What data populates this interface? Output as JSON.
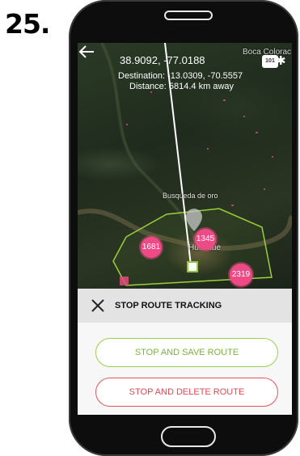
{
  "step": "25.",
  "map": {
    "current_coords": "38.9092, -77.0188",
    "destination": "Destination: -13.0309, -70.5557",
    "distance": "Distance: 5814.4 km away",
    "place_labels": {
      "boca": "Boca Colorac",
      "busqueda": "Busqueda de oro",
      "hue": "Hu... itue"
    },
    "road_shield": "101",
    "clusters": [
      {
        "label": "1681"
      },
      {
        "label": "1345"
      },
      {
        "label": "2319"
      }
    ]
  },
  "tracking": {
    "title": "STOP ROUTE TRACKING"
  },
  "actions": {
    "save_label": "STOP AND SAVE ROUTE",
    "delete_label": "STOP AND DELETE ROUTE"
  },
  "colors": {
    "accent_green": "#8ec63f",
    "accent_red": "#e2555f",
    "cluster_pink": "#ee4a86"
  }
}
